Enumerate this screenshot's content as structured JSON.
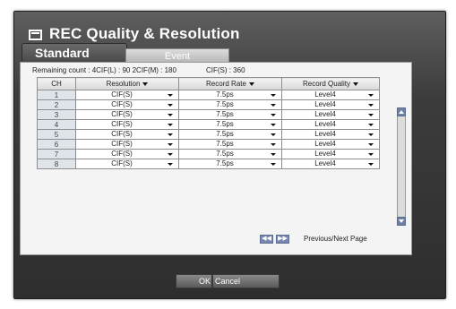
{
  "window": {
    "title": "REC Quality & Resolution",
    "tabs": [
      "Standard",
      "Event"
    ]
  },
  "remaining": {
    "part1": "Remaining count : 4CIF(L) : 90 2CIF(M) : 180",
    "part2": "CIF(S) : 360"
  },
  "table": {
    "headers": [
      "CH",
      "Resolution",
      "Record Rate",
      "Record Quality"
    ],
    "rows": [
      {
        "ch": "1",
        "resolution": "CIF(S)",
        "rate": "7.5ps",
        "quality": "Level4"
      },
      {
        "ch": "2",
        "resolution": "CIF(S)",
        "rate": "7.5ps",
        "quality": "Level4"
      },
      {
        "ch": "3",
        "resolution": "CIF(S)",
        "rate": "7.5ps",
        "quality": "Level4"
      },
      {
        "ch": "4",
        "resolution": "CIF(S)",
        "rate": "7.5ps",
        "quality": "Level4"
      },
      {
        "ch": "5",
        "resolution": "CIF(S)",
        "rate": "7.5ps",
        "quality": "Level4"
      },
      {
        "ch": "6",
        "resolution": "CIF(S)",
        "rate": "7.5ps",
        "quality": "Level4"
      },
      {
        "ch": "7",
        "resolution": "CIF(S)",
        "rate": "7.5ps",
        "quality": "Level4"
      },
      {
        "ch": "8",
        "resolution": "CIF(S)",
        "rate": "7.5ps",
        "quality": "Level4"
      }
    ]
  },
  "pagination": {
    "label": "Previous/Next Page"
  },
  "buttons": {
    "ok": "OK",
    "cancel": "Cancel"
  },
  "colors": {
    "window": "#3c3c3c",
    "panel": "#f4f4f4",
    "accent": "#7888ad"
  }
}
